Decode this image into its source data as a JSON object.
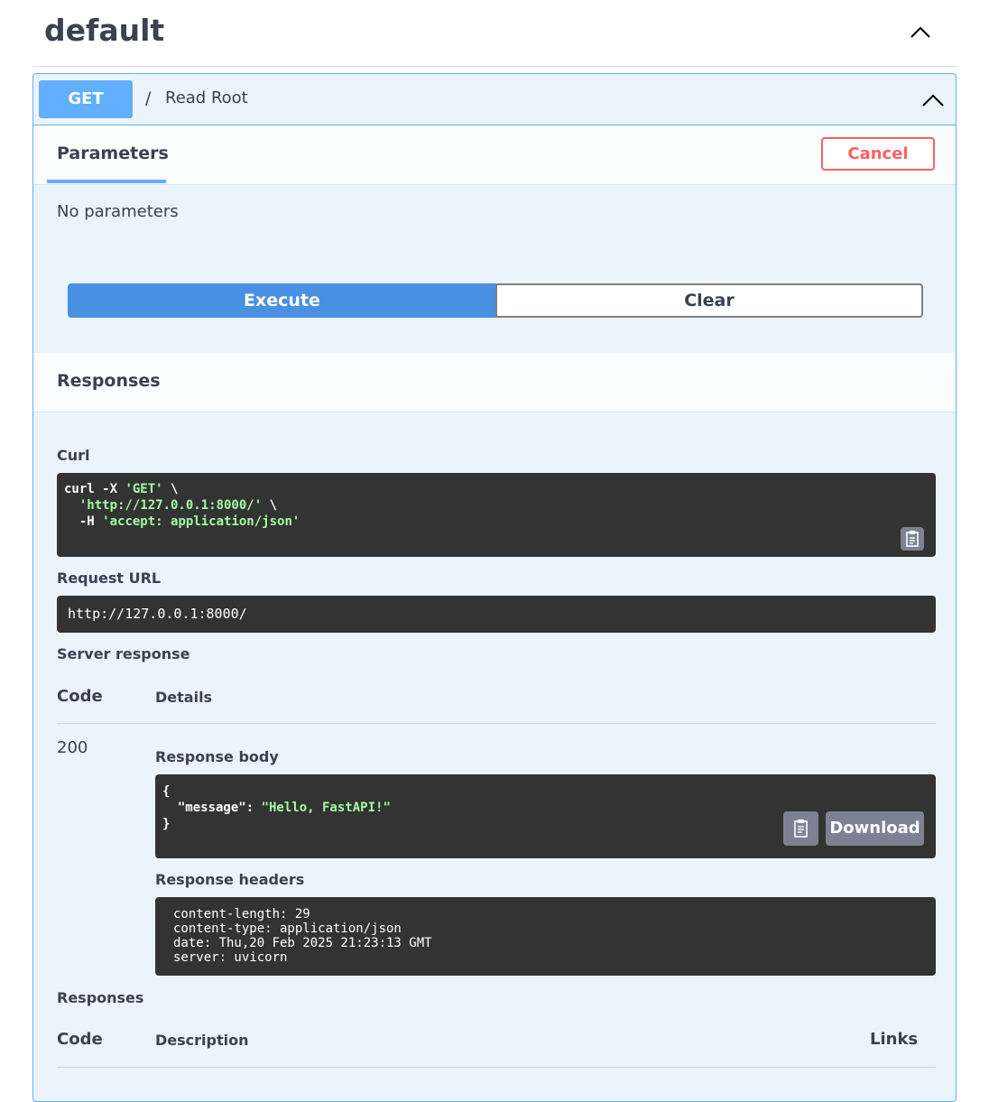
{
  "tag": {
    "title": "default"
  },
  "operation": {
    "method": "GET",
    "path": "/",
    "summary": "Read Root"
  },
  "parameters": {
    "tab_label": "Parameters",
    "cancel_label": "Cancel",
    "empty_text": "No parameters"
  },
  "actions": {
    "execute_label": "Execute",
    "clear_label": "Clear"
  },
  "responses_section": {
    "title": "Responses"
  },
  "curl": {
    "label": "Curl",
    "line1_cmd": "curl -X ",
    "line1_str": "'GET'",
    "line1_tail": " \\",
    "line2_str": "  'http://127.0.0.1:8000/'",
    "line2_tail": " \\",
    "line3_cmd": "  -H ",
    "line3_str": "'accept: application/json'"
  },
  "request_url": {
    "label": "Request URL",
    "value": "http://127.0.0.1:8000/"
  },
  "server_response": {
    "label": "Server response",
    "code_header": "Code",
    "details_header": "Details",
    "code": "200",
    "body_label": "Response body",
    "body_open": "{",
    "body_key": "  \"message\": ",
    "body_value": "\"Hello, FastAPI!\"",
    "body_close": "}",
    "download_label": "Download",
    "headers_label": "Response headers",
    "headers": [
      "content-length: 29",
      "content-type: application/json",
      "date: Thu,20 Feb 2025 21:23:13 GMT",
      "server: uvicorn"
    ]
  },
  "responses_table": {
    "label": "Responses",
    "code_header": "Code",
    "description_header": "Description",
    "links_header": "Links"
  },
  "icons": {
    "tag_toggle": "chevron-up-icon",
    "op_toggle": "chevron-up-icon",
    "copy": "clipboard-icon"
  },
  "colors": {
    "get": "#61affe",
    "execute": "#4990e2",
    "cancel": "#ff6060",
    "code_bg": "#333333",
    "string": "#a2fca2"
  }
}
